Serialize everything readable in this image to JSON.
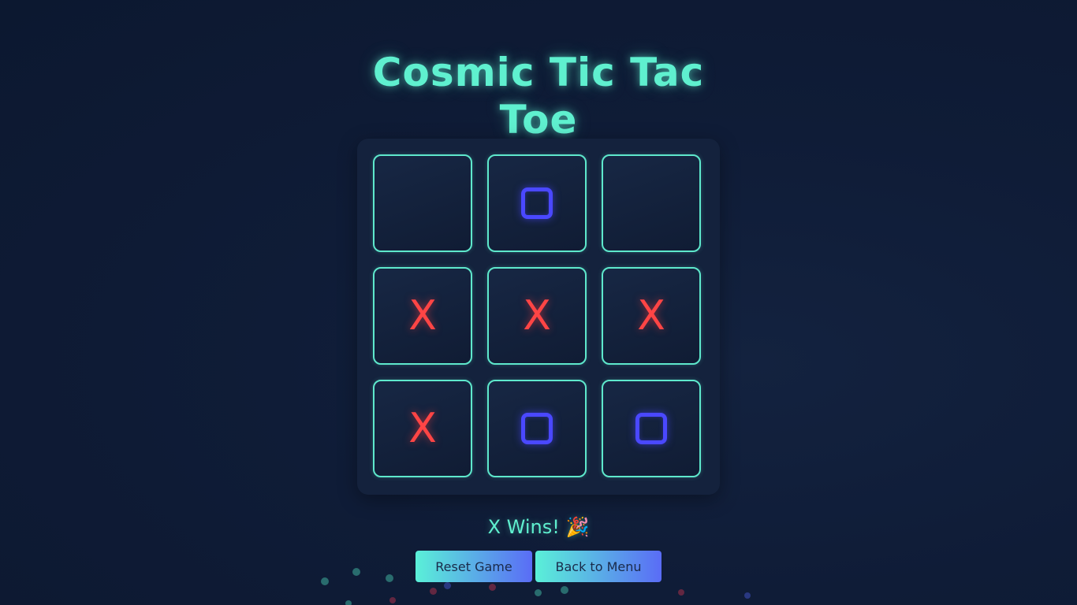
{
  "title": {
    "line1": "Cosmic Tic Tac",
    "line2": "Toe"
  },
  "board": {
    "cells": [
      "",
      "O",
      "",
      "X",
      "X",
      "X",
      "X",
      "O",
      "O"
    ]
  },
  "status": {
    "text": "X Wins! 🎉"
  },
  "buttons": {
    "reset_label": "Reset Game",
    "menu_label": "Back to Menu"
  },
  "colors": {
    "accent": "#5ff0cf",
    "x_mark": "#ff4545",
    "o_mark": "#4a48ff",
    "background": "#0f1c37"
  }
}
